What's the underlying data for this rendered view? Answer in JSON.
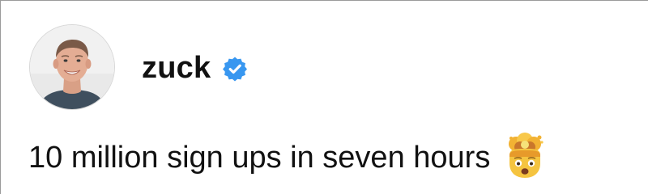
{
  "post": {
    "username": "zuck",
    "verified": true,
    "text": "10 million sign ups in seven hours",
    "emoji": "exploding-head-icon"
  },
  "colors": {
    "verified_badge": "#3897F0",
    "text": "#111111",
    "background": "#FFFFFF"
  }
}
